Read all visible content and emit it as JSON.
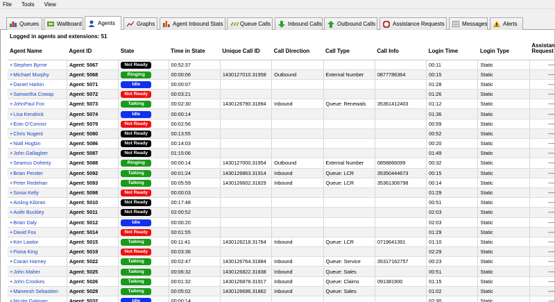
{
  "menu": [
    "File",
    "Tools",
    "View"
  ],
  "tabs": [
    {
      "label": "Queues",
      "icon": "queues-icon",
      "color": "#3a8a3a"
    },
    {
      "label": "Wallboard",
      "icon": "wallboard-icon",
      "color": "#6a9a30"
    },
    {
      "label": "Agents",
      "icon": "agents-icon",
      "color": "#2a4aa0"
    },
    {
      "label": "Graphs",
      "icon": "graphs-icon",
      "color": "#b02020"
    },
    {
      "label": "Agent Inbound Stats",
      "icon": "stats-icon",
      "color": "#a04020"
    },
    {
      "label": "Queue Calls",
      "icon": "queue-calls-icon",
      "color": "#80a020"
    },
    {
      "label": "Inbound Calls",
      "icon": "inbound-arrow-icon",
      "color": "#30a030"
    },
    {
      "label": "Outbound Calls",
      "icon": "outbound-arrow-icon",
      "color": "#30a030"
    },
    {
      "label": "Assistance Requests",
      "icon": "assistance-icon",
      "color": "#c03030"
    },
    {
      "label": "Messages",
      "icon": "messages-icon",
      "color": "#909090"
    },
    {
      "label": "Alerts",
      "icon": "alert-icon",
      "color": "#e0a000"
    }
  ],
  "summary": "Logged in agents and extensions: 51",
  "columns": [
    "Agent Name",
    "Agent ID",
    "State",
    "Time in State",
    "Unique Call ID",
    "Call Direction",
    "Call Type",
    "Call Info",
    "Login Time",
    "Login Type",
    "Assistance Request"
  ],
  "state_colors": {
    "Not Ready": "#000000",
    "Ringing": "#1a9a1a",
    "Idle": "#1030ee",
    "Talking": "#1a9a1a",
    "Not Ready Red": "#ee1010"
  },
  "rows": [
    {
      "name": "Stephen Byrne",
      "id": "Agent: 5067",
      "state": "Not Ready",
      "color": "#000000",
      "time": "00:52:37",
      "callid": "",
      "dir": "",
      "type": "",
      "info": "",
      "login": "00:11",
      "ltype": "Static",
      "assist": "----"
    },
    {
      "name": "Michael Murphy",
      "id": "Agent: 5068",
      "state": "Ringing",
      "color": "#1a9a1a",
      "time": "00:00:06",
      "callid": "1430127010.31958",
      "dir": "Outbound",
      "type": "External Number",
      "info": "0877786364",
      "login": "00:15",
      "ltype": "Static",
      "assist": "----"
    },
    {
      "name": "Daniel Harkin",
      "id": "Agent: 5071",
      "state": "Idle",
      "color": "#1030ee",
      "time": "00:00:07",
      "callid": "",
      "dir": "",
      "type": "",
      "info": "",
      "login": "01:28",
      "ltype": "Static",
      "assist": "----"
    },
    {
      "name": "Samantha Cowap",
      "id": "Agent: 5072",
      "state": "Not Ready",
      "color": "#ee1010",
      "time": "00:03:21",
      "callid": "",
      "dir": "",
      "type": "",
      "info": "",
      "login": "01:26",
      "ltype": "Static",
      "assist": "----"
    },
    {
      "name": "JohnPaul Fox",
      "id": "Agent: 5073",
      "state": "Talking",
      "color": "#1a9a1a",
      "time": "00:02:30",
      "callid": "1430126790.31894",
      "dir": "Inbound",
      "type": "Queue: Renewals",
      "info": "35361412403",
      "login": "01:12",
      "ltype": "Static",
      "assist": "----"
    },
    {
      "name": "Lisa Kendrick",
      "id": "Agent: 5074",
      "state": "Idle",
      "color": "#1030ee",
      "time": "00:00:14",
      "callid": "",
      "dir": "",
      "type": "",
      "info": "",
      "login": "01:36",
      "ltype": "Static",
      "assist": "----"
    },
    {
      "name": "Eoin O'Connor",
      "id": "Agent: 5079",
      "state": "Not Ready",
      "color": "#ee1010",
      "time": "00:02:56",
      "callid": "",
      "dir": "",
      "type": "",
      "info": "",
      "login": "00:59",
      "ltype": "Static",
      "assist": "----"
    },
    {
      "name": "Chris Nugent",
      "id": "Agent: 5080",
      "state": "Not Ready",
      "color": "#000000",
      "time": "00:13:55",
      "callid": "",
      "dir": "",
      "type": "",
      "info": "",
      "login": "00:52",
      "ltype": "Static",
      "assist": "----"
    },
    {
      "name": "Niall Hogbin",
      "id": "Agent: 5086",
      "state": "Not Ready",
      "color": "#000000",
      "time": "00:14:03",
      "callid": "",
      "dir": "",
      "type": "",
      "info": "",
      "login": "00:20",
      "ltype": "Static",
      "assist": "----"
    },
    {
      "name": "John Gallagher",
      "id": "Agent: 5087",
      "state": "Not Ready",
      "color": "#000000",
      "time": "01:15:06",
      "callid": "",
      "dir": "",
      "type": "",
      "info": "",
      "login": "01:49",
      "ltype": "Static",
      "assist": "----"
    },
    {
      "name": "Seamus Doherty",
      "id": "Agent: 5088",
      "state": "Ringing",
      "color": "#1a9a1a",
      "time": "00:00:14",
      "callid": "1430127000.31954",
      "dir": "Outbound",
      "type": "External Number",
      "info": "0858866099",
      "login": "00:32",
      "ltype": "Static",
      "assist": "----"
    },
    {
      "name": "Brian Pender",
      "id": "Agent: 5092",
      "state": "Talking",
      "color": "#1a9a1a",
      "time": "00:01:24",
      "callid": "1430126863.31914",
      "dir": "Inbound",
      "type": "Queue: LCR",
      "info": "35350444673",
      "login": "00:15",
      "ltype": "Static",
      "assist": "----"
    },
    {
      "name": "Peter Redehan",
      "id": "Agent: 5093",
      "state": "Talking",
      "color": "#1a9a1a",
      "time": "00:05:59",
      "callid": "1430126602.31829",
      "dir": "Inbound",
      "type": "Queue: LCR",
      "info": "35361306798",
      "login": "00:14",
      "ltype": "Static",
      "assist": "----"
    },
    {
      "name": "Sonia Kelly",
      "id": "Agent: 5098",
      "state": "Not Ready",
      "color": "#ee1010",
      "time": "00:00:03",
      "callid": "",
      "dir": "",
      "type": "",
      "info": "",
      "login": "01:29",
      "ltype": "Static",
      "assist": "----"
    },
    {
      "name": "Aisling Kiloran",
      "id": "Agent: 5010",
      "state": "Not Ready",
      "color": "#000000",
      "time": "00:17:48",
      "callid": "",
      "dir": "",
      "type": "",
      "info": "",
      "login": "00:51",
      "ltype": "Static",
      "assist": "----"
    },
    {
      "name": "Aoife Buckley",
      "id": "Agent: 5011",
      "state": "Not Ready",
      "color": "#000000",
      "time": "02:00:52",
      "callid": "",
      "dir": "",
      "type": "",
      "info": "",
      "login": "02:03",
      "ltype": "Static",
      "assist": "----"
    },
    {
      "name": "Brian Daly",
      "id": "Agent: 5012",
      "state": "Idle",
      "color": "#1030ee",
      "time": "00:00:20",
      "callid": "",
      "dir": "",
      "type": "",
      "info": "",
      "login": "02:03",
      "ltype": "Static",
      "assist": "----"
    },
    {
      "name": "David Fox",
      "id": "Agent: 5014",
      "state": "Not Ready",
      "color": "#ee1010",
      "time": "00:01:55",
      "callid": "",
      "dir": "",
      "type": "",
      "info": "",
      "login": "01:29",
      "ltype": "Static",
      "assist": "----"
    },
    {
      "name": "Kim Lawlor",
      "id": "Agent: 5015",
      "state": "Talking",
      "color": "#1a9a1a",
      "time": "00:11:41",
      "callid": "1430126218.31764",
      "dir": "Inbound",
      "type": "Queue: LCR",
      "info": "0719641391",
      "login": "01:10",
      "ltype": "Static",
      "assist": "----"
    },
    {
      "name": "Fiona King",
      "id": "Agent: 5019",
      "state": "Not Ready",
      "color": "#ee1010",
      "time": "00:03:36",
      "callid": "",
      "dir": "",
      "type": "",
      "info": "",
      "login": "02:29",
      "ltype": "Static",
      "assist": "----"
    },
    {
      "name": "Ciaran Harney",
      "id": "Agent: 5022",
      "state": "Talking",
      "color": "#1a9a1a",
      "time": "00:02:47",
      "callid": "1430126764.31884",
      "dir": "Inbound",
      "type": "Queue: Service",
      "info": "35317162757",
      "login": "00:23",
      "ltype": "Static",
      "assist": "----"
    },
    {
      "name": "John Maher",
      "id": "Agent: 5025",
      "state": "Talking",
      "color": "#1a9a1a",
      "time": "00:06:32",
      "callid": "1430126822.31838",
      "dir": "Inbound",
      "type": "Queue: Sales",
      "info": "",
      "login": "00:51",
      "ltype": "Static",
      "assist": "----"
    },
    {
      "name": "John Crookes",
      "id": "Agent: 5026",
      "state": "Talking",
      "color": "#1a9a1a",
      "time": "00:01:32",
      "callid": "1430126878.31917",
      "dir": "Inbound",
      "type": "Queue: Claims",
      "info": "091381900",
      "login": "01:15",
      "ltype": "Static",
      "assist": "----"
    },
    {
      "name": "Maneesh Sebastien",
      "id": "Agent: 5029",
      "state": "Talking",
      "color": "#1a9a1a",
      "time": "00:05:02",
      "callid": "1430126696.31862",
      "dir": "Inbound",
      "type": "Queue: Sales",
      "info": "",
      "login": "01:02",
      "ltype": "Static",
      "assist": "----"
    },
    {
      "name": "Nicole Galavan",
      "id": "Agent: 5032",
      "state": "Idle",
      "color": "#1030ee",
      "time": "00:00:14",
      "callid": "",
      "dir": "",
      "type": "",
      "info": "",
      "login": "02:30",
      "ltype": "Static",
      "assist": "----"
    }
  ]
}
